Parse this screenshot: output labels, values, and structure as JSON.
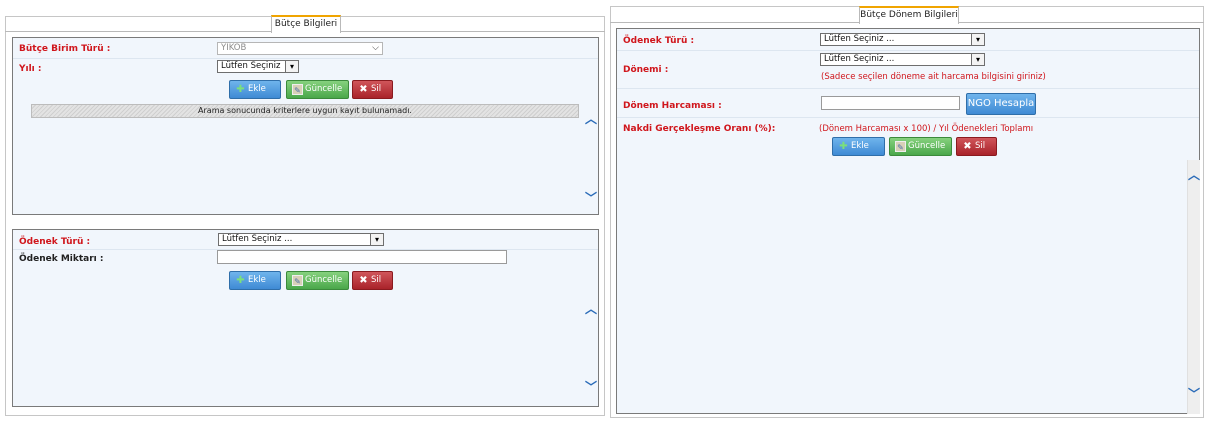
{
  "left_panel": {
    "tab_label": "Bütçe Bilgileri",
    "budget_section": {
      "birim_turu_label": "Bütçe Birim Türü :",
      "birim_turu_value": "YİKOB",
      "yil_label": "Yılı :",
      "yil_value": "Lütfen Seçiniz",
      "buttons": {
        "add": "Ekle",
        "update": "Güncelle",
        "delete": "Sil"
      },
      "empty_message": "Arama sonucunda kriterlere uygun kayıt bulunamadı."
    },
    "allowance_section": {
      "odenek_turu_label": "Ödenek Türü :",
      "odenek_turu_value": "Lütfen Seçiniz ...",
      "odenek_miktari_label": "Ödenek Miktarı :",
      "odenek_miktari_value": "",
      "buttons": {
        "add": "Ekle",
        "update": "Güncelle",
        "delete": "Sil"
      }
    }
  },
  "right_panel": {
    "tab_label": "Bütçe Dönem Bilgileri",
    "odenek_turu_label": "Ödenek Türü :",
    "odenek_turu_value": "Lütfen Seçiniz ...",
    "donemi_label": "Dönemi :",
    "donemi_value": "Lütfen Seçiniz ...",
    "donemi_note": "(Sadece seçilen döneme ait harcama bilgisini giriniz)",
    "donem_harcamasi_label": "Dönem Harcaması :",
    "donem_harcamasi_value": "",
    "ngo_button": "NGO Hesapla",
    "oran_label": "Nakdi Gerçekleşme Oranı (%):",
    "oran_formula": "(Dönem Harcaması x 100) / Yıl Ödenekleri Toplamı",
    "buttons": {
      "add": "Ekle",
      "update": "Güncelle",
      "delete": "Sil"
    }
  },
  "icons": {
    "add": "plus-icon",
    "update": "edit-icon",
    "delete": "x-icon",
    "dropdown": "chevron-down-icon",
    "scroll_up": "chevron-up-icon",
    "scroll_down": "chevron-down-icon"
  },
  "colors": {
    "required_label": "#d0161c",
    "tab_accent": "#f0a400",
    "section_background": "#f1f6fc",
    "add_button": "#3f8ad4",
    "update_button": "#4aa74a",
    "delete_button": "#a9232a"
  }
}
